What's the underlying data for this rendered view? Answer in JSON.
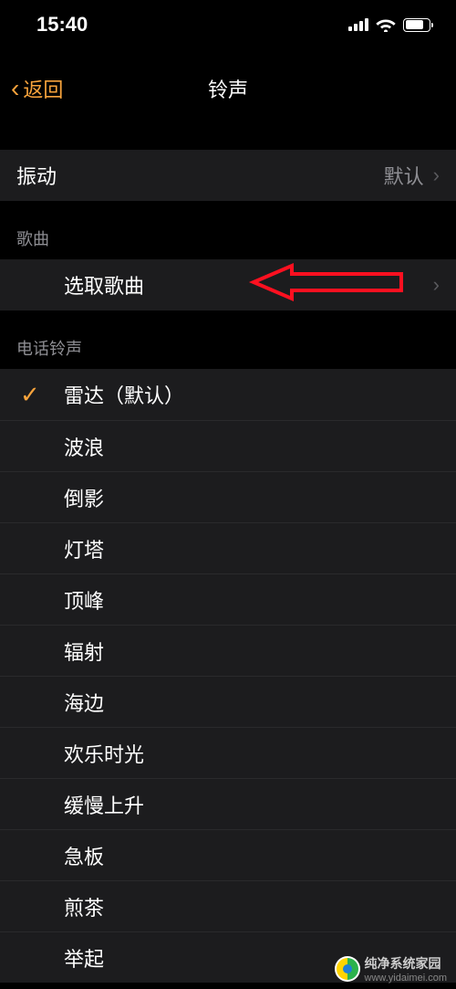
{
  "status": {
    "time": "15:40"
  },
  "nav": {
    "back_label": "返回",
    "title": "铃声"
  },
  "vibration": {
    "label": "振动",
    "value": "默认"
  },
  "song_section": {
    "header": "歌曲",
    "select_label": "选取歌曲"
  },
  "ringtone_section": {
    "header": "电话铃声",
    "items": [
      {
        "label": "雷达（默认）",
        "selected": true
      },
      {
        "label": "波浪",
        "selected": false
      },
      {
        "label": "倒影",
        "selected": false
      },
      {
        "label": "灯塔",
        "selected": false
      },
      {
        "label": "顶峰",
        "selected": false
      },
      {
        "label": "辐射",
        "selected": false
      },
      {
        "label": "海边",
        "selected": false
      },
      {
        "label": "欢乐时光",
        "selected": false
      },
      {
        "label": "缓慢上升",
        "selected": false
      },
      {
        "label": "急板",
        "selected": false
      },
      {
        "label": "煎茶",
        "selected": false
      },
      {
        "label": "举起",
        "selected": false
      }
    ]
  },
  "watermark": {
    "brand": "纯净系统家园",
    "url": "www.yidaimei.com"
  }
}
